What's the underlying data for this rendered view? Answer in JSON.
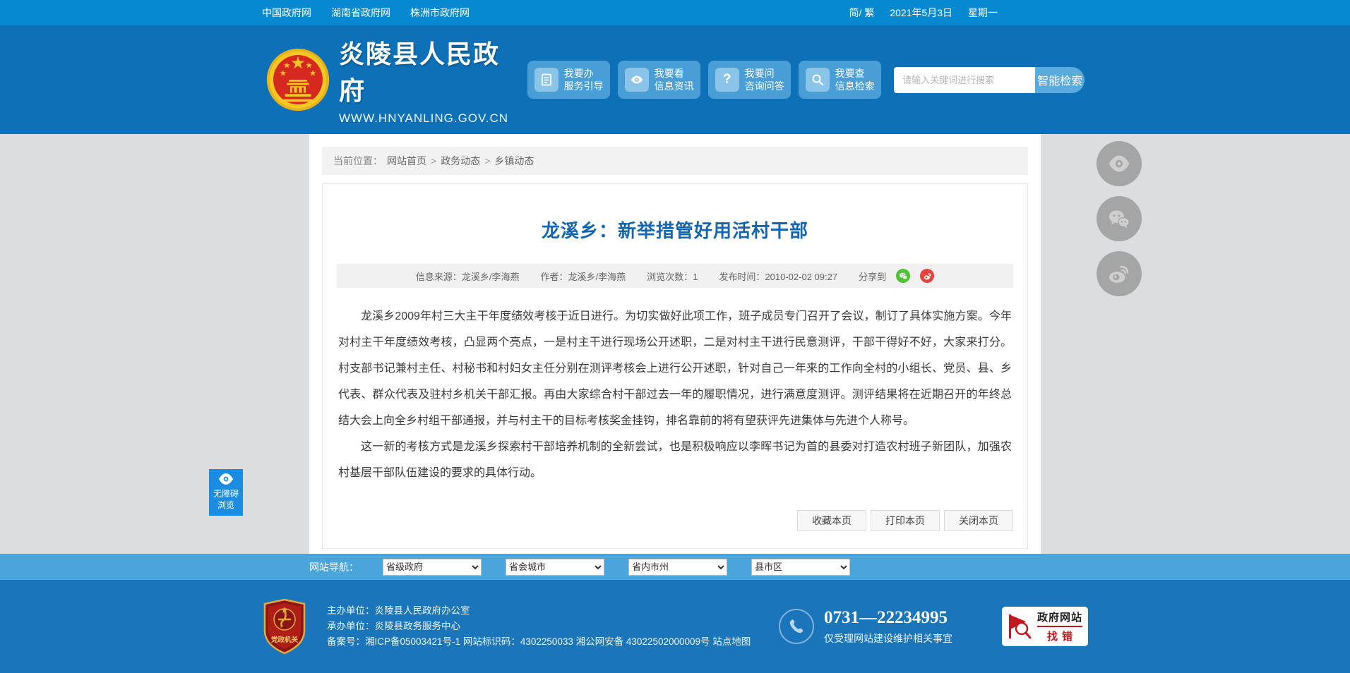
{
  "topbar": {
    "links": [
      "中国政府网",
      "湖南省政府网",
      "株洲市政府网"
    ],
    "lang_toggle": "简/ 繁",
    "date": "2021年5月3日",
    "weekday": "星期一"
  },
  "header": {
    "site_name": "炎陵县人民政府",
    "site_url": "WWW.HNYANLING.GOV.CN",
    "actions": [
      {
        "line1": "我要办",
        "line2": "服务引导",
        "icon": "document-icon"
      },
      {
        "line1": "我要看",
        "line2": "信息资讯",
        "icon": "eye-icon"
      },
      {
        "line1": "我要问",
        "line2": "咨询问答",
        "icon": "question-icon"
      },
      {
        "line1": "我要查",
        "line2": "信息检索",
        "icon": "search-icon"
      }
    ],
    "search": {
      "placeholder": "请输入关键词进行搜索",
      "button": "智能检索"
    }
  },
  "breadcrumb": {
    "label": "当前位置：",
    "items": [
      "网站首页",
      "政务动态",
      "乡镇动态"
    ],
    "separator": ">"
  },
  "article": {
    "title": "龙溪乡：新举措管好用活村干部",
    "meta": {
      "source_label": "信息来源：",
      "source": "龙溪乡/李海燕",
      "author_label": "作者：",
      "author": "龙溪乡/李海燕",
      "views_label": "浏览次数：",
      "views": "1",
      "publish_label": "发布时间：",
      "publish_time": "2010-02-02 09:27",
      "share_label": "分享到"
    },
    "paragraphs": [
      "龙溪乡2009年村三大主干年度绩效考核于近日进行。为切实做好此项工作，班子成员专门召开了会议，制订了具体实施方案。今年对村主干年度绩效考核，凸显两个亮点，一是村主干进行现场公开述职，二是对村主干进行民意测评，干部干得好不好，大家来打分。村支部书记兼村主任、村秘书和村妇女主任分别在测评考核会上进行公开述职，针对自己一年来的工作向全村的小组长、党员、县、乡代表、群众代表及驻村乡机关干部汇报。再由大家综合村干部过去一年的履职情况，进行满意度测评。测评结果将在近期召开的年终总结大会上向全乡村组干部通报，并与村主干的目标考核奖金挂钩，排名靠前的将有望获评先进集体与先进个人称号。",
      "这一新的考核方式是龙溪乡探索村干部培养机制的全新尝试，也是积极响应以李晖书记为首的县委对打造农村班子新团队，加强农村基层干部队伍建设的要求的具体行动。"
    ],
    "actions": [
      "收藏本页",
      "打印本页",
      "关闭本页"
    ]
  },
  "floating": {
    "accessibility_line1": "无障碍",
    "accessibility_line2": "浏览"
  },
  "site_nav": {
    "label": "网站导航：",
    "selects": [
      "省级政府",
      "省会城市",
      "省内市州",
      "县市区"
    ]
  },
  "footer": {
    "shield_label": "党政机关",
    "info": [
      {
        "label": "主办单位：",
        "value": "炎陵县人民政府办公室"
      },
      {
        "label": "承办单位：",
        "value": "炎陵县政务服务中心"
      },
      {
        "label": "备案号：",
        "value": "湘ICP备05003421号-1 网站标识码：4302250033 湘公网安备 43022502000009号",
        "link": "站点地图"
      }
    ],
    "phone": "0731—22234995",
    "phone_note": "仅受理网站建设维护相关事宜",
    "error_badge": {
      "line1": "政府网站",
      "line2": "找错"
    }
  },
  "colors": {
    "topbar": "#0689d1",
    "header": "#0e71b8",
    "accent_light_blue": "#4aa5da",
    "footer": "#1a75bb",
    "title_blue": "#1765af",
    "wechat_green": "#4ec434",
    "weibo_red": "#e6443d"
  }
}
